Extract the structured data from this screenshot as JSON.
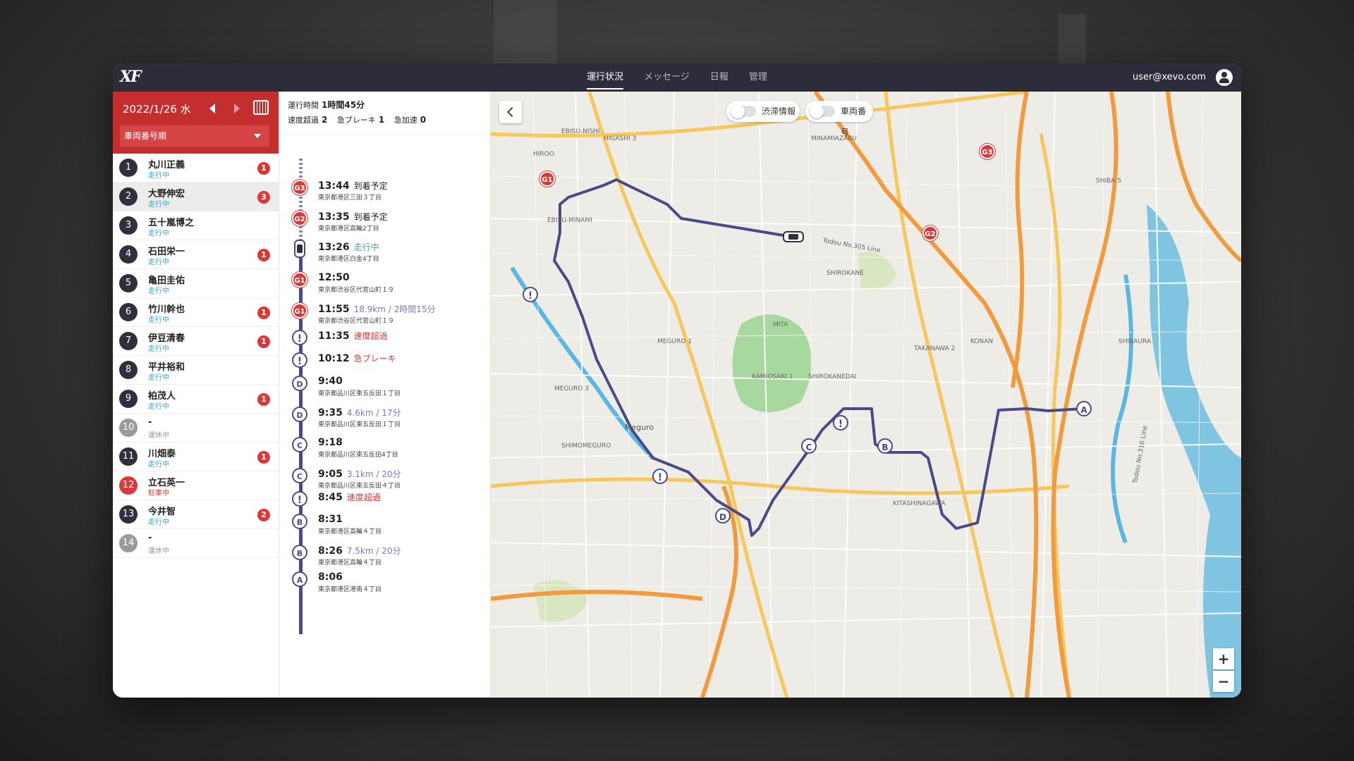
{
  "app": {
    "logo": "XF",
    "nav": [
      "運行状況",
      "メッセージ",
      "日報",
      "管理"
    ],
    "user": "user@xevo.com"
  },
  "left": {
    "date": "2022/1/26 水",
    "sort_label": "車両番号順",
    "vehicles": [
      {
        "num": "1",
        "name": "丸川正義",
        "status": "走行中",
        "badge": "1"
      },
      {
        "num": "2",
        "name": "大野伸宏",
        "status": "走行中",
        "badge": "3"
      },
      {
        "num": "3",
        "name": "五十嵐博之",
        "status": "走行中",
        "badge": ""
      },
      {
        "num": "4",
        "name": "石田栄一",
        "status": "走行中",
        "badge": "1"
      },
      {
        "num": "5",
        "name": "亀田圭佑",
        "status": "走行中",
        "badge": ""
      },
      {
        "num": "6",
        "name": "竹川幹也",
        "status": "走行中",
        "badge": "1"
      },
      {
        "num": "7",
        "name": "伊豆清春",
        "status": "走行中",
        "badge": "1"
      },
      {
        "num": "8",
        "name": "平井裕和",
        "status": "走行中",
        "badge": ""
      },
      {
        "num": "9",
        "name": "柏茂人",
        "status": "走行中",
        "badge": "1"
      },
      {
        "num": "10",
        "name": "-",
        "status": "運休中",
        "badge": ""
      },
      {
        "num": "11",
        "name": "川畑泰",
        "status": "走行中",
        "badge": "1"
      },
      {
        "num": "12",
        "name": "立石英一",
        "status": "駐車中",
        "badge": ""
      },
      {
        "num": "13",
        "name": "今井智",
        "status": "走行中",
        "badge": "2"
      },
      {
        "num": "14",
        "name": "-",
        "status": "運休中",
        "badge": ""
      }
    ]
  },
  "summary": {
    "drive_time_label": "運行時間",
    "drive_time_value": "1時間45分",
    "speeding_label": "速度超過",
    "speeding_value": "2",
    "brake_label": "急ブレーキ",
    "brake_value": "1",
    "accel_label": "急加速",
    "accel_value": "0"
  },
  "timeline": [
    {
      "marker": "G3",
      "type": "goal",
      "time": "13:44",
      "note": "到着予定",
      "note_color": "dark",
      "addr": "東京都港区三田３丁目"
    },
    {
      "marker": "G2",
      "type": "goal",
      "time": "13:35",
      "note": "到着予定",
      "note_color": "dark",
      "addr": "東京都港区高輪2丁目"
    },
    {
      "marker": "",
      "type": "car",
      "time": "13:26",
      "note": "走行中",
      "note_color": "cyan",
      "addr": "東京都港区白金4丁目"
    },
    {
      "marker": "G1",
      "type": "goal",
      "time": "12:50",
      "note": "",
      "note_color": "dark",
      "addr": "東京都渋谷区代官山町１９"
    },
    {
      "marker": "G1",
      "type": "goal",
      "time": "11:55",
      "note": "18.9km / 2時間15分",
      "note_color": "blue",
      "addr": "東京都渋谷区代官山町１９"
    },
    {
      "marker": "!",
      "type": "alert",
      "time": "11:35",
      "note": "速度超過",
      "note_color": "red",
      "addr": ""
    },
    {
      "marker": "!",
      "type": "alert",
      "time": "10:12",
      "note": "急ブレーキ",
      "note_color": "red",
      "addr": ""
    },
    {
      "marker": "D",
      "type": "letter",
      "time": "9:40",
      "note": "",
      "note_color": "dark",
      "addr": "東京都品川区東五反田１丁目"
    },
    {
      "marker": "D",
      "type": "letter",
      "time": "9:35",
      "note": "4.6km / 17分",
      "note_color": "blue",
      "addr": "東京都品川区東五反田１丁目"
    },
    {
      "marker": "C",
      "type": "letter",
      "time": "9:18",
      "note": "",
      "note_color": "dark",
      "addr": "東京都品川区東五反田4丁目"
    },
    {
      "marker": "C",
      "type": "letter",
      "time": "9:05",
      "note": "3.1km / 20分",
      "note_color": "blue",
      "addr": "東京都品川区東五反田４丁目"
    },
    {
      "marker": "!",
      "type": "alert",
      "time": "8:45",
      "note": "速度超過",
      "note_color": "red",
      "addr": ""
    },
    {
      "marker": "B",
      "type": "letter",
      "time": "8:31",
      "note": "",
      "note_color": "dark",
      "addr": "東京都港区高輪４丁目"
    },
    {
      "marker": "B",
      "type": "letter",
      "time": "8:26",
      "note": "7.5km / 20分",
      "note_color": "blue",
      "addr": "東京都港区高輪４丁目"
    },
    {
      "marker": "A",
      "type": "letter",
      "time": "8:06",
      "note": "",
      "note_color": "dark",
      "addr": "東京都港区港南４丁目"
    }
  ],
  "map": {
    "toggle_traffic": "渋滞情報",
    "toggle_vehicle_no": "車両番号",
    "zoom_in": "+",
    "zoom_out": "−",
    "labels": [
      "EBISU-NISHI",
      "HIGASHI 3",
      "MINAMIAZABU",
      "EBISU-MINAMI",
      "MITA",
      "MEGURO 1",
      "SHIROKANE",
      "KAMIOSAKI 1",
      "SHIROKANEDAI",
      "TAKANAWA 2",
      "KONAN",
      "SHIBAURA",
      "KITASHINAGAWA",
      "Meguro",
      "SHIMOMEGURO",
      "HIROO",
      "SHIBA 5",
      "MEGURO 3",
      "Todou No.305 Line",
      "Todou No.316 Line"
    ],
    "markers": [
      "G1",
      "G2",
      "G3",
      "A",
      "B",
      "C",
      "D",
      "!",
      "!",
      "!"
    ],
    "colors": {
      "route": "#4a4a8a",
      "major_road": "#f39a3c",
      "arterial": "#f7c75a",
      "water": "#5ab8e0",
      "park": "#a7d99e"
    }
  }
}
